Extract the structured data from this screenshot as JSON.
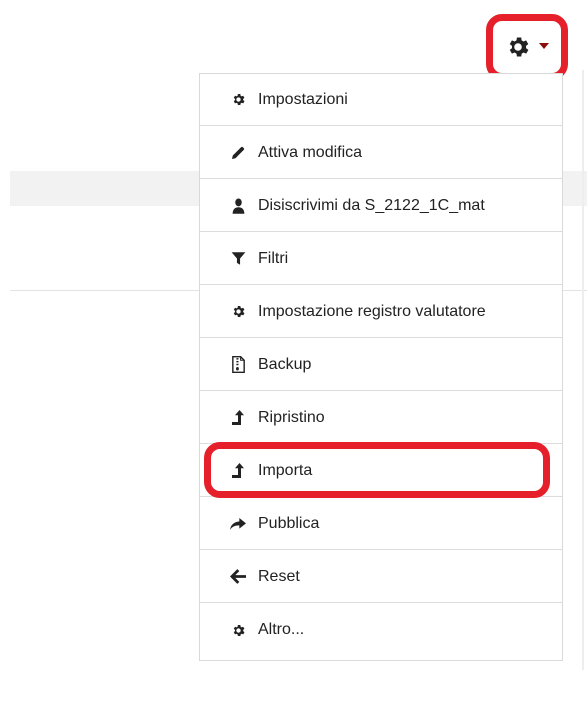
{
  "trigger": {
    "icon": "gear-icon",
    "caret_icon": "caret-down-icon"
  },
  "menu": {
    "items": [
      {
        "label": "Impostazioni",
        "icon": "gear-icon"
      },
      {
        "label": "Attiva modifica",
        "icon": "pencil-icon"
      },
      {
        "label": "Disiscrivimi da S_2122_1C_mat",
        "icon": "user-icon"
      },
      {
        "label": "Filtri",
        "icon": "filter-icon"
      },
      {
        "label": "Impostazione registro valutatore",
        "icon": "gear-icon"
      },
      {
        "label": "Backup",
        "icon": "file-archive-icon"
      },
      {
        "label": "Ripristino",
        "icon": "upload-arrow-icon"
      },
      {
        "label": "Importa",
        "icon": "upload-arrow-icon"
      },
      {
        "label": "Pubblica",
        "icon": "share-arrow-icon"
      },
      {
        "label": "Reset",
        "icon": "arrow-left-icon"
      },
      {
        "label": "Altro...",
        "icon": "gear-icon"
      }
    ]
  },
  "colors": {
    "highlight": "#e5202a",
    "icon": "#222222",
    "caret": "#8b0d0d"
  }
}
